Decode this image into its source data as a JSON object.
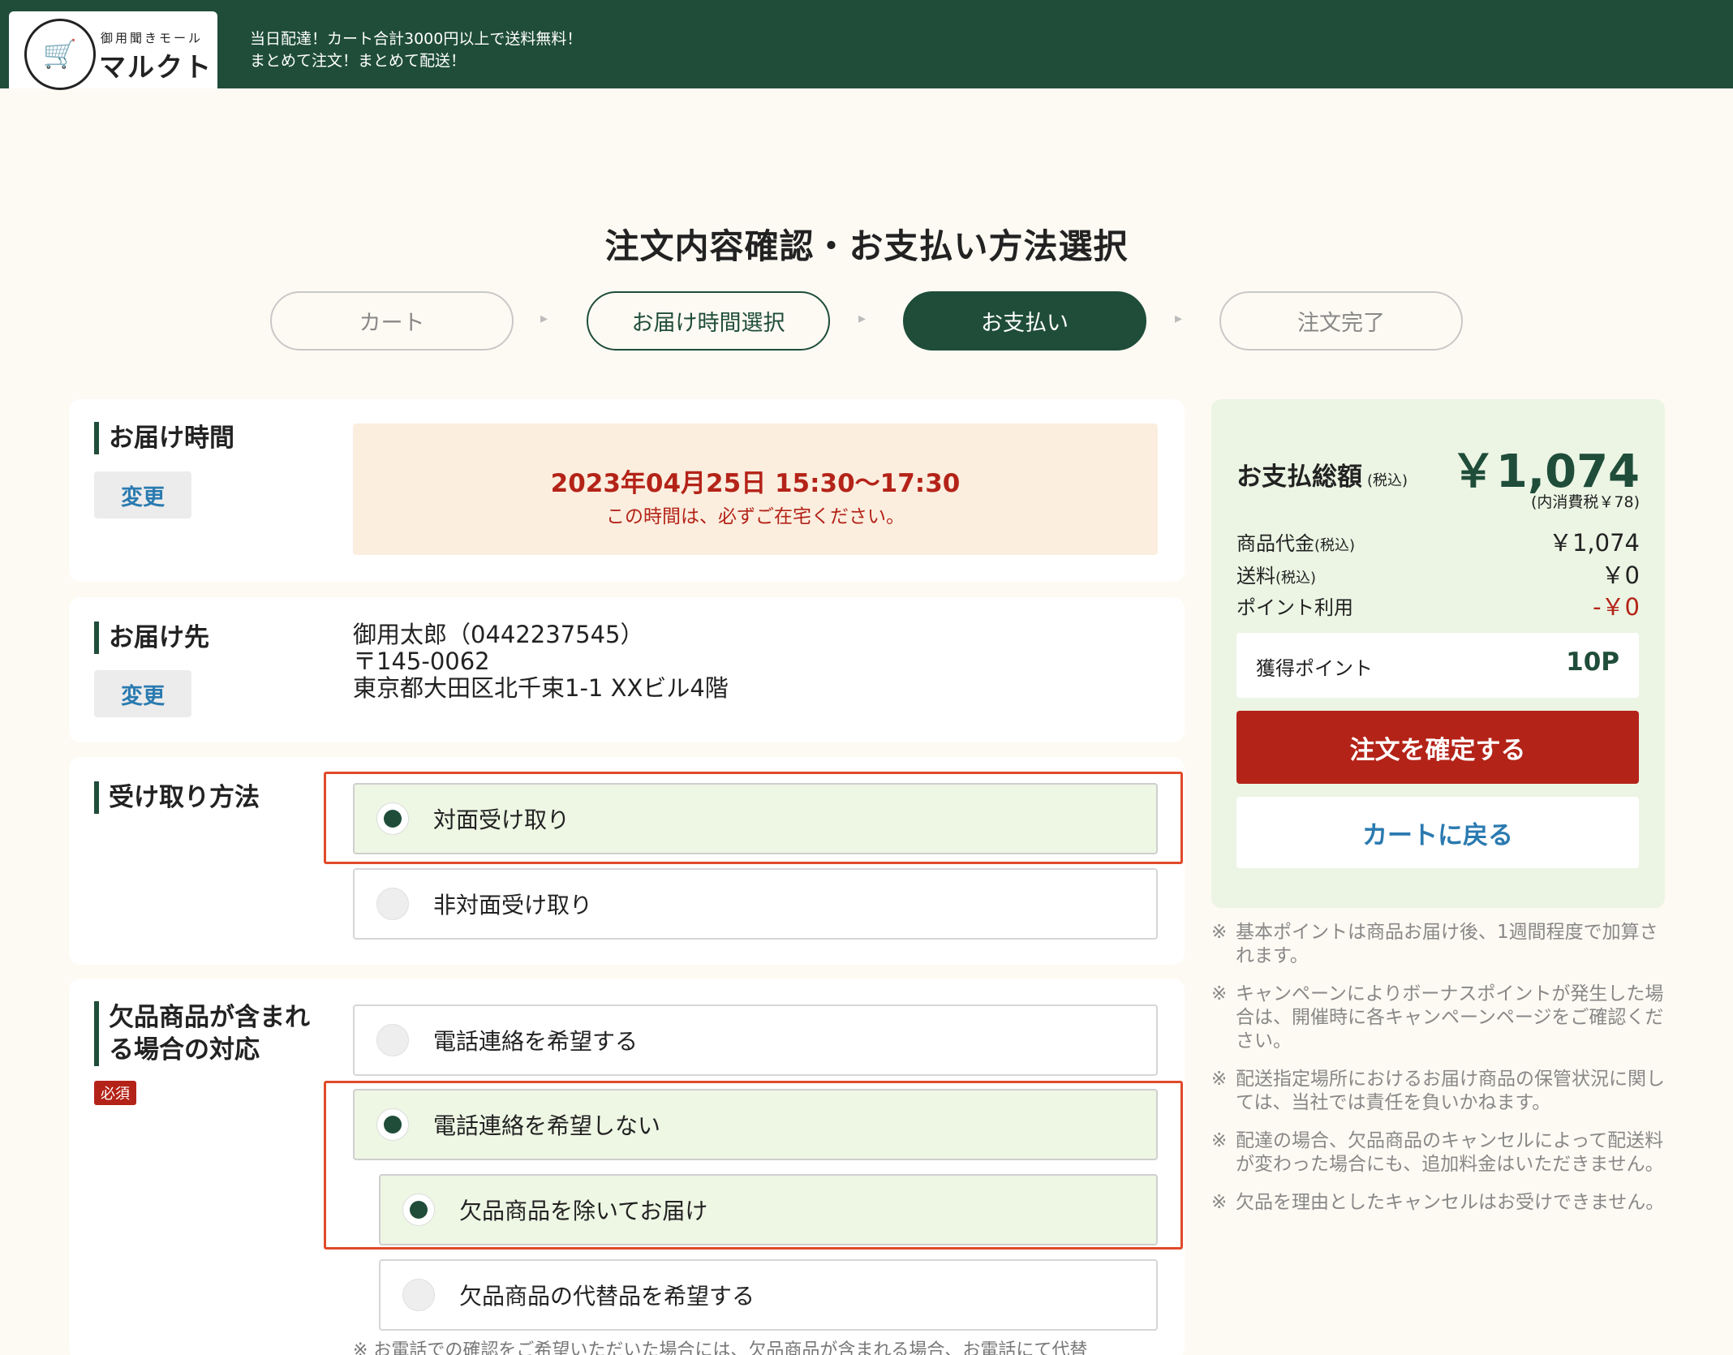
{
  "header": {
    "logo_sub": "御用聞きモール",
    "logo_main": "マルクト",
    "msg_line1": "当日配達！カート合計3000円以上で送料無料！",
    "msg_line2": "まとめて注文！まとめて配送！"
  },
  "page_title": "注文内容確認・お支払い方法選択",
  "steps": [
    "カート",
    "お届け時間選択",
    "お支払い",
    "注文完了"
  ],
  "step_arrow": "▸",
  "delivery_time": {
    "title": "お届け時間",
    "change": "変更",
    "datetime": "2023年04月25日 15:30〜17:30",
    "note": "この時間は、必ずご在宅ください。"
  },
  "delivery_address": {
    "title": "お届け先",
    "change": "変更",
    "line1": "御用太郎（0442237545）",
    "line2": "〒145-0062",
    "line3": "東京都大田区北千束1-1 XXビル4階"
  },
  "receive_method": {
    "title": "受け取り方法",
    "options": [
      "対面受け取り",
      "非対面受け取り"
    ],
    "selected": 0
  },
  "out_of_stock": {
    "title_line1": "欠品商品が含まれ",
    "title_line2": "る場合の対応",
    "required": "必須",
    "options": [
      "電話連絡を希望する",
      "電話連絡を希望しない"
    ],
    "sub_options": [
      "欠品商品を除いてお届け",
      "欠品商品の代替品を希望する"
    ],
    "note": "※ お電話での確認をご希望いただいた場合には、欠品商品が含まれる場合、お電話にて代替"
  },
  "summary": {
    "total_label": "お支払総額",
    "tax_incl": "(税込)",
    "total": "￥1,074",
    "tax_note": "(内消費税￥78)",
    "item_label": "商品代金",
    "item_value": "￥1,074",
    "shipping_label": "送料",
    "shipping_value": "￥0",
    "points_use_label": "ポイント利用",
    "points_use_value": "-￥0",
    "earned_label": "獲得ポイント",
    "earned_value": "10P",
    "confirm": "注文を確定する",
    "back": "カートに戻る"
  },
  "notes": [
    "基本ポイントは商品お届け後、1週間程度で加算されます。",
    "キャンペーンによりボーナスポイントが発生した場合は、開催時に各キャンペーンページをご確認ください。",
    "配送指定場所におけるお届け商品の保管状況に関しては、当社では責任を負いかねます。",
    "配達の場合、欠品商品のキャンセルによって配送料が変わった場合にも、追加料金はいただきません。",
    "欠品を理由としたキャンセルはお受けできません。"
  ],
  "note_mark": "※",
  "colors": {
    "brand": "#1f4d3a",
    "accent_red": "#b42318",
    "link": "#2a7ab0",
    "highlight": "#e04a2a"
  }
}
